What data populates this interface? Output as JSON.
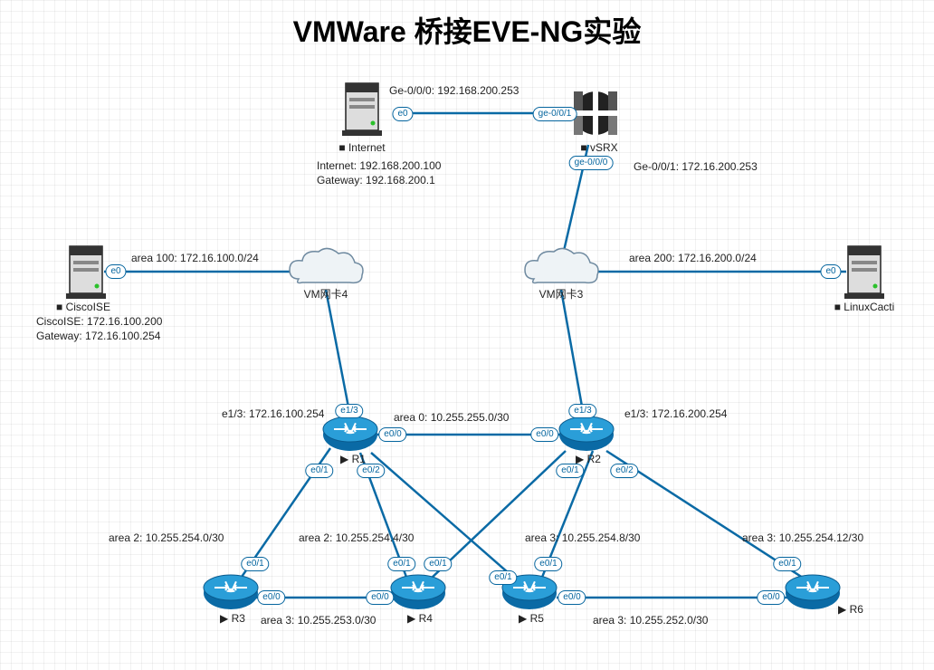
{
  "title": "VMWare 桥接EVE-NG实验",
  "nodes": {
    "internet": {
      "label": "Internet"
    },
    "vsrx": {
      "label": "vSRX"
    },
    "ciscoise": {
      "label": "CiscoISE"
    },
    "linuxcacti": {
      "label": "LinuxCacti"
    },
    "vmnic4": {
      "label": "VM网卡4"
    },
    "vmnic3": {
      "label": "VM网卡3"
    },
    "r1": {
      "label": "R1"
    },
    "r2": {
      "label": "R2"
    },
    "r3": {
      "label": "R3"
    },
    "r4": {
      "label": "R4"
    },
    "r5": {
      "label": "R5"
    },
    "r6": {
      "label": "R6"
    }
  },
  "texts": {
    "ge000": "Ge-0/0/0: 192.168.200.253",
    "ge001": "Ge-0/0/1: 172.16.200.253",
    "internet_ip": "Internet: 192.168.200.100",
    "internet_gw": "Gateway: 192.168.200.1",
    "ciscoise_ip": "CiscoISE: 172.16.100.200",
    "ciscoise_gw": "Gateway: 172.16.100.254",
    "area100": "area 100: 172.16.100.0/24",
    "area200": "area 200: 172.16.200.0/24",
    "r1_e13": "e1/3: 172.16.100.254",
    "r2_e13": "e1/3: 172.16.200.254",
    "area0": "area  0: 10.255.255.0/30",
    "area2_a": "area  2: 10.255.254.0/30",
    "area2_b": "area  2: 10.255.254.4/30",
    "area3_a": "area  3: 10.255.254.8/30",
    "area3_b": "area  3: 10.255.254.12/30",
    "area3_c": "area  3: 10.255.253.0/30",
    "area3_d": "area  3: 10.255.252.0/30"
  },
  "if": {
    "e0": "e0",
    "ge000": "ge-0/0/0",
    "ge001": "ge-0/0/1",
    "e13": "e1/3",
    "e00": "e0/0",
    "e01": "e0/1",
    "e02": "e0/2"
  }
}
